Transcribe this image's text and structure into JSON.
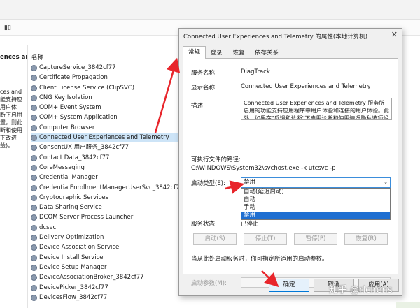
{
  "console": {
    "left_title": "ences and",
    "left_desc_lines": [
      "ces and",
      "能支持应",
      "用户体",
      "断下启用",
      "置，则此",
      "断和使用",
      "下改进",
      "益)。"
    ],
    "column_header": "名称",
    "services": [
      "CaptureService_3842cf77",
      "Certificate Propagation",
      "Client License Service (ClipSVC)",
      "CNG Key Isolation",
      "COM+ Event System",
      "COM+ System Application",
      "Computer Browser",
      "Connected User Experiences and Telemetry",
      "ConsentUX 用户服务_3842cf77",
      "Contact Data_3842cf77",
      "CoreMessaging",
      "Credential Manager",
      "CredentialEnrollmentManagerUserSvc_3842cf77",
      "Cryptographic Services",
      "Data Sharing Service",
      "DCOM Server Process Launcher",
      "dcsvc",
      "Delivery Optimization",
      "Device Association Service",
      "Device Install Service",
      "Device Setup Manager",
      "DeviceAssociationBroker_3842cf77",
      "DevicePicker_3842cf77",
      "DevicesFlow_3842cf77"
    ],
    "selected_index": 7
  },
  "dialog": {
    "title": "Connected User Experiences and Telemetry 的属性(本地计算机)",
    "close_glyph": "✕",
    "tabs": [
      "常规",
      "登录",
      "恢复",
      "依存关系"
    ],
    "active_tab": 0,
    "service_name_label": "服务名称:",
    "service_name": "DiagTrack",
    "display_name_label": "显示名称:",
    "display_name": "Connected User Experiences and Telemetry",
    "description_label": "描述:",
    "description": "Connected User Experiences and Telemetry 服务所启用的功能支持应用程序中用户体验和连接的用户体验。此外，如果在\"反馈和诊断\"下启用诊断和使用情况隐私选项设置，则此服务可以管理诊断和使用情况信息的收集和传输(用于改进 Windows 平台的体验和质量)。",
    "exec_path_label": "可执行文件的路径:",
    "exec_path": "C:\\WINDOWS\\System32\\svchost.exe -k utcsvc -p",
    "startup_type_label": "启动类型(E):",
    "startup_type_value": "禁用",
    "startup_options": [
      "自动(延迟启动)",
      "自动",
      "手动",
      "禁用"
    ],
    "highlighted_option": 3,
    "service_status_label": "服务状态:",
    "service_status": "已停止",
    "start_btn": "启动(S)",
    "stop_btn": "停止(T)",
    "pause_btn": "暂停(P)",
    "resume_btn": "恢复(R)",
    "hint": "当从此处启动服务时，你可指定所适用的启动参数。",
    "start_params_label": "启动参数(M):",
    "ok_btn": "确定",
    "cancel_btn": "取消",
    "apply_btn": "应用(A)"
  },
  "annotations": {
    "arrow_color": "#e8252b",
    "watermark": "知乎 @rlchens"
  }
}
